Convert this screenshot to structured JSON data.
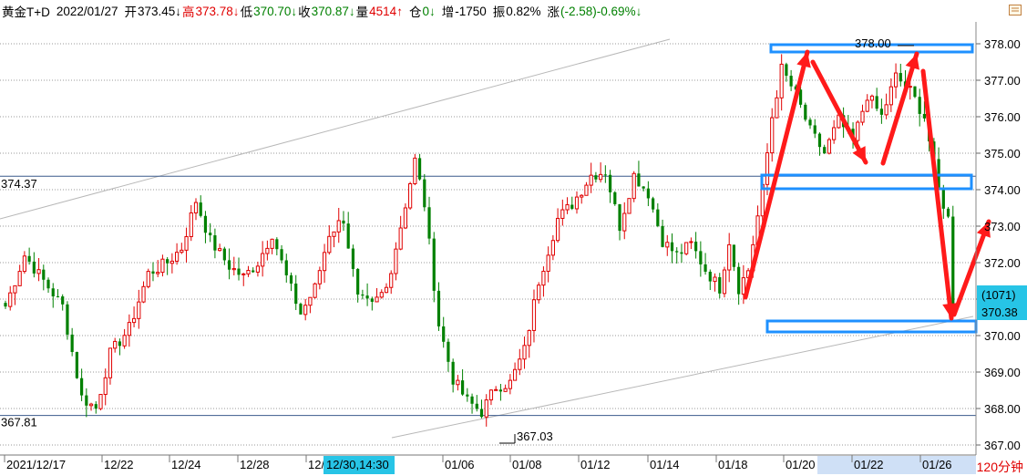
{
  "info": {
    "symbol": "黄金T+D",
    "date": "2022/01/27",
    "open_label": "开",
    "open": "373.45↓",
    "high_label": "高",
    "high": "373.78↓",
    "low_label": "低",
    "low": "370.70↓",
    "close_label": "收",
    "close": "370.87↓",
    "volume_label": "量",
    "volume": "4514↑",
    "position_label": "仓",
    "position": "0↓",
    "increase_label": "增",
    "increase": "-1750",
    "amplitude_label": "振",
    "amplitude": "0.82%",
    "change_label": "涨",
    "change": "(-2.58)-0.69%↓"
  },
  "colors": {
    "up": "#e00000",
    "down": "#008000",
    "grid": "#9a9a9a",
    "box": "#1e90ff",
    "arrow": "#ff1a1a",
    "cursor_bg": "#27c4e6"
  },
  "period": "120分钟",
  "cursor_time": "12/30,14:30",
  "current": {
    "count": "(1071)",
    "price": "370.38"
  },
  "annotations": {
    "left_high_line": "374.37",
    "left_low_line": "367.81",
    "peak": "378.00",
    "trough": "367.03"
  },
  "chart_data": {
    "type": "candlestick",
    "y_axis": {
      "min": 366.8,
      "max": 378.4,
      "ticks": [
        "367.00",
        "368.00",
        "369.00",
        "370.00",
        "371.00",
        "372.00",
        "373.00",
        "374.00",
        "375.00",
        "376.00",
        "377.00",
        "378.00"
      ]
    },
    "x_axis_labels": [
      "2021/12/17",
      "12/22",
      "12/24",
      "12/28",
      "12/30",
      "01/06",
      "01/08",
      "01/12",
      "01/14",
      "01/18",
      "01/20",
      "01/22",
      "01/26"
    ],
    "horizontal_lines": [
      374.37,
      367.81
    ],
    "anchors": [
      {
        "i": 0,
        "v": 370.8
      },
      {
        "i": 4,
        "v": 372.2
      },
      {
        "i": 8,
        "v": 371.5
      },
      {
        "i": 12,
        "v": 370.8
      },
      {
        "i": 16,
        "v": 368.3
      },
      {
        "i": 19,
        "v": 368.0
      },
      {
        "i": 22,
        "v": 369.5
      },
      {
        "i": 26,
        "v": 370.2
      },
      {
        "i": 30,
        "v": 371.7
      },
      {
        "i": 34,
        "v": 372.0
      },
      {
        "i": 37,
        "v": 372.4
      },
      {
        "i": 40,
        "v": 373.7
      },
      {
        "i": 43,
        "v": 372.6
      },
      {
        "i": 47,
        "v": 371.9
      },
      {
        "i": 50,
        "v": 371.6
      },
      {
        "i": 53,
        "v": 372.0
      },
      {
        "i": 56,
        "v": 372.8
      },
      {
        "i": 59,
        "v": 371.6
      },
      {
        "i": 62,
        "v": 370.6
      },
      {
        "i": 65,
        "v": 371.3
      },
      {
        "i": 68,
        "v": 372.8
      },
      {
        "i": 71,
        "v": 373.2
      },
      {
        "i": 74,
        "v": 371.0
      },
      {
        "i": 77,
        "v": 370.8
      },
      {
        "i": 80,
        "v": 371.3
      },
      {
        "i": 83,
        "v": 373.0
      },
      {
        "i": 86,
        "v": 374.8
      },
      {
        "i": 88,
        "v": 373.6
      },
      {
        "i": 91,
        "v": 370.3
      },
      {
        "i": 94,
        "v": 368.8
      },
      {
        "i": 97,
        "v": 368.2
      },
      {
        "i": 100,
        "v": 367.9
      },
      {
        "i": 103,
        "v": 368.6
      },
      {
        "i": 106,
        "v": 368.7
      },
      {
        "i": 109,
        "v": 369.6
      },
      {
        "i": 112,
        "v": 371.5
      },
      {
        "i": 116,
        "v": 373.2
      },
      {
        "i": 119,
        "v": 373.6
      },
      {
        "i": 123,
        "v": 374.4
      },
      {
        "i": 126,
        "v": 374.5
      },
      {
        "i": 129,
        "v": 373.0
      },
      {
        "i": 132,
        "v": 374.4
      },
      {
        "i": 135,
        "v": 373.9
      },
      {
        "i": 138,
        "v": 372.6
      },
      {
        "i": 141,
        "v": 372.2
      },
      {
        "i": 144,
        "v": 372.5
      },
      {
        "i": 147,
        "v": 371.8
      },
      {
        "i": 150,
        "v": 371.3
      },
      {
        "i": 152,
        "v": 372.6
      },
      {
        "i": 154,
        "v": 371.3
      },
      {
        "i": 156,
        "v": 371.8
      },
      {
        "i": 159,
        "v": 374.0
      },
      {
        "i": 161,
        "v": 376.0
      },
      {
        "i": 163,
        "v": 377.3
      },
      {
        "i": 166,
        "v": 376.6
      },
      {
        "i": 169,
        "v": 375.6
      },
      {
        "i": 172,
        "v": 375.0
      },
      {
        "i": 175,
        "v": 375.9
      },
      {
        "i": 178,
        "v": 375.3
      },
      {
        "i": 181,
        "v": 376.6
      },
      {
        "i": 184,
        "v": 376.0
      },
      {
        "i": 187,
        "v": 377.1
      },
      {
        "i": 190,
        "v": 376.7
      },
      {
        "i": 193,
        "v": 376.0
      },
      {
        "i": 196,
        "v": 374.0
      },
      {
        "i": 198,
        "v": 373.2
      },
      {
        "i": 199,
        "v": 370.8
      }
    ]
  }
}
